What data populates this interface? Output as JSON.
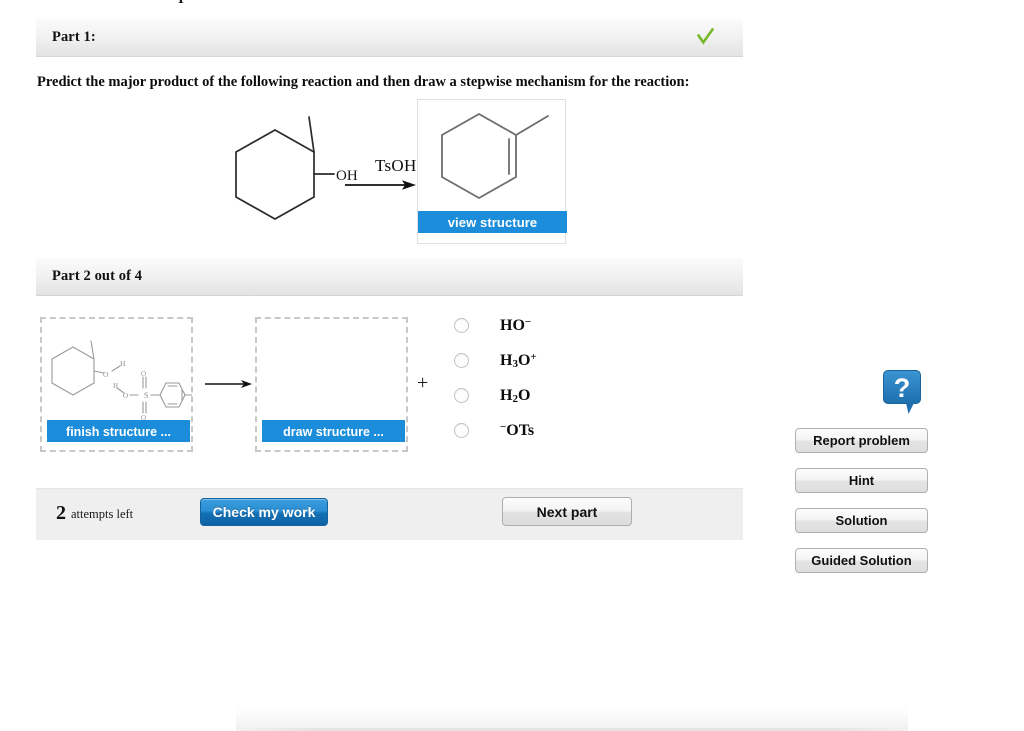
{
  "top_clip_glyph": "I",
  "part1": {
    "header_title": "Part 1:",
    "status_icon": "green-check-icon",
    "status_color": "#76b82a",
    "prompt": "Predict the major product of the following reaction and then draw a stepwise mechanism for the reaction:",
    "reagent_label": "TsOH",
    "reactant_name": "1-methylcyclohexanol",
    "reactant_substituent_label": "OH",
    "product_name": "1-methylcyclohexene",
    "view_structure_label": "view structure",
    "accent_color": "#1b8ddb"
  },
  "part2": {
    "header_title": "Part 2 out of 4",
    "left_box": {
      "button_label": "finish structure ...",
      "structure_labels": [
        "H",
        "O",
        "H",
        "O",
        "O",
        "S",
        "O"
      ]
    },
    "right_box": {
      "button_label": "draw structure ..."
    },
    "plus": "+",
    "options": [
      {
        "id": "opt-ho-minus",
        "html": "HO<sup>&minus;</sup>",
        "text": "HO-",
        "selected": false
      },
      {
        "id": "opt-h3o-plus",
        "html": "H<sub>3</sub>O<sup>+</sup>",
        "text": "H3O+",
        "selected": false
      },
      {
        "id": "opt-h2o",
        "html": "H<sub>2</sub>O",
        "text": "H2O",
        "selected": false
      },
      {
        "id": "opt-ots-minus",
        "html": "<sup>&minus;</sup>OTs",
        "text": "-OTs",
        "selected": false
      }
    ]
  },
  "footer": {
    "attempts_count": "2",
    "attempts_label": "attempts left",
    "check_label": "Check my work",
    "next_label": "Next part"
  },
  "sidebar": {
    "help_icon": "question-mark-bubble-icon",
    "help_glyph": "?",
    "buttons": [
      {
        "label": "Report problem",
        "name": "report-problem-button"
      },
      {
        "label": "Hint",
        "name": "hint-button"
      },
      {
        "label": "Solution",
        "name": "solution-button"
      },
      {
        "label": "Guided Solution",
        "name": "guided-solution-button"
      }
    ]
  }
}
